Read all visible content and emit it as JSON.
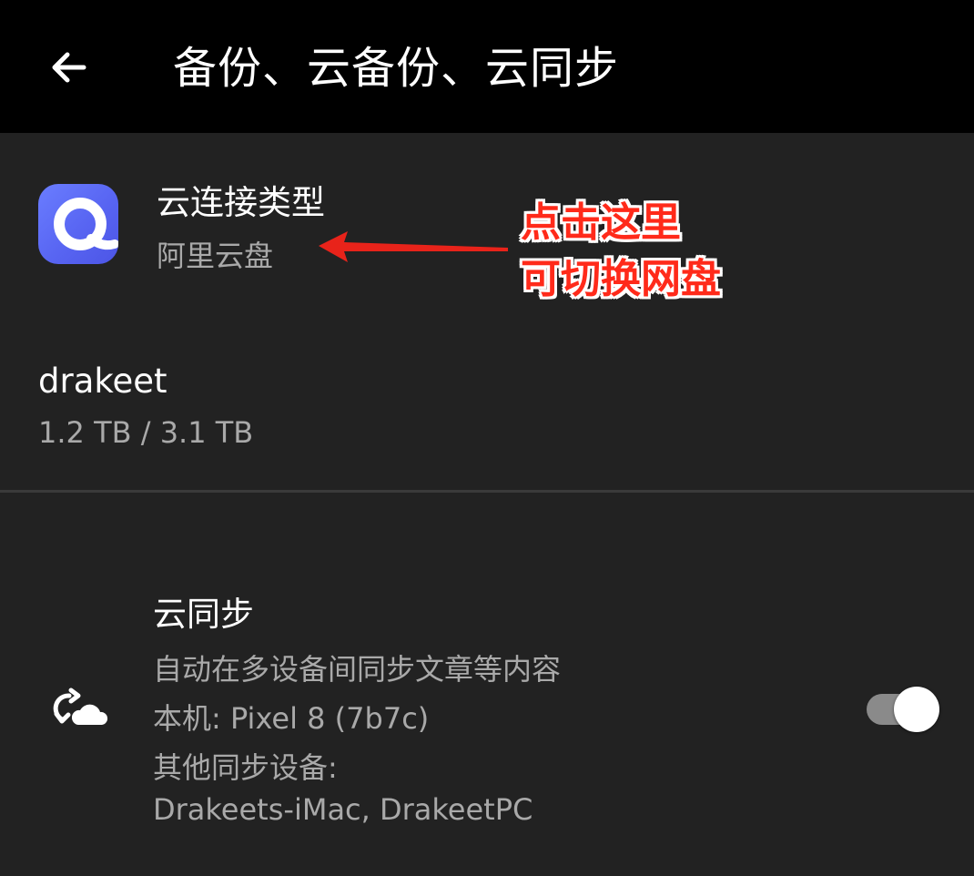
{
  "header": {
    "title": "备份、云备份、云同步",
    "back_icon": "arrow-left-icon"
  },
  "cloud_type": {
    "title": "云连接类型",
    "value": "阿里云盘",
    "icon": "aliyun-drive-icon",
    "icon_color": "#5865f2"
  },
  "account": {
    "name": "drakeet",
    "usage": "1.2 TB / 3.1 TB"
  },
  "cloud_sync": {
    "title": "云同步",
    "description": "自动在多设备间同步文章等内容",
    "this_device": "本机: Pixel 8 (7b7c)",
    "other_devices_label": "其他同步设备:",
    "other_devices": "Drakeets-iMac, DrakeetPC",
    "icon": "cloud-sync-icon",
    "enabled": true
  },
  "annotation": {
    "line1": "点击这里",
    "line2": "可切换网盘",
    "color": "#ff2a1a"
  }
}
